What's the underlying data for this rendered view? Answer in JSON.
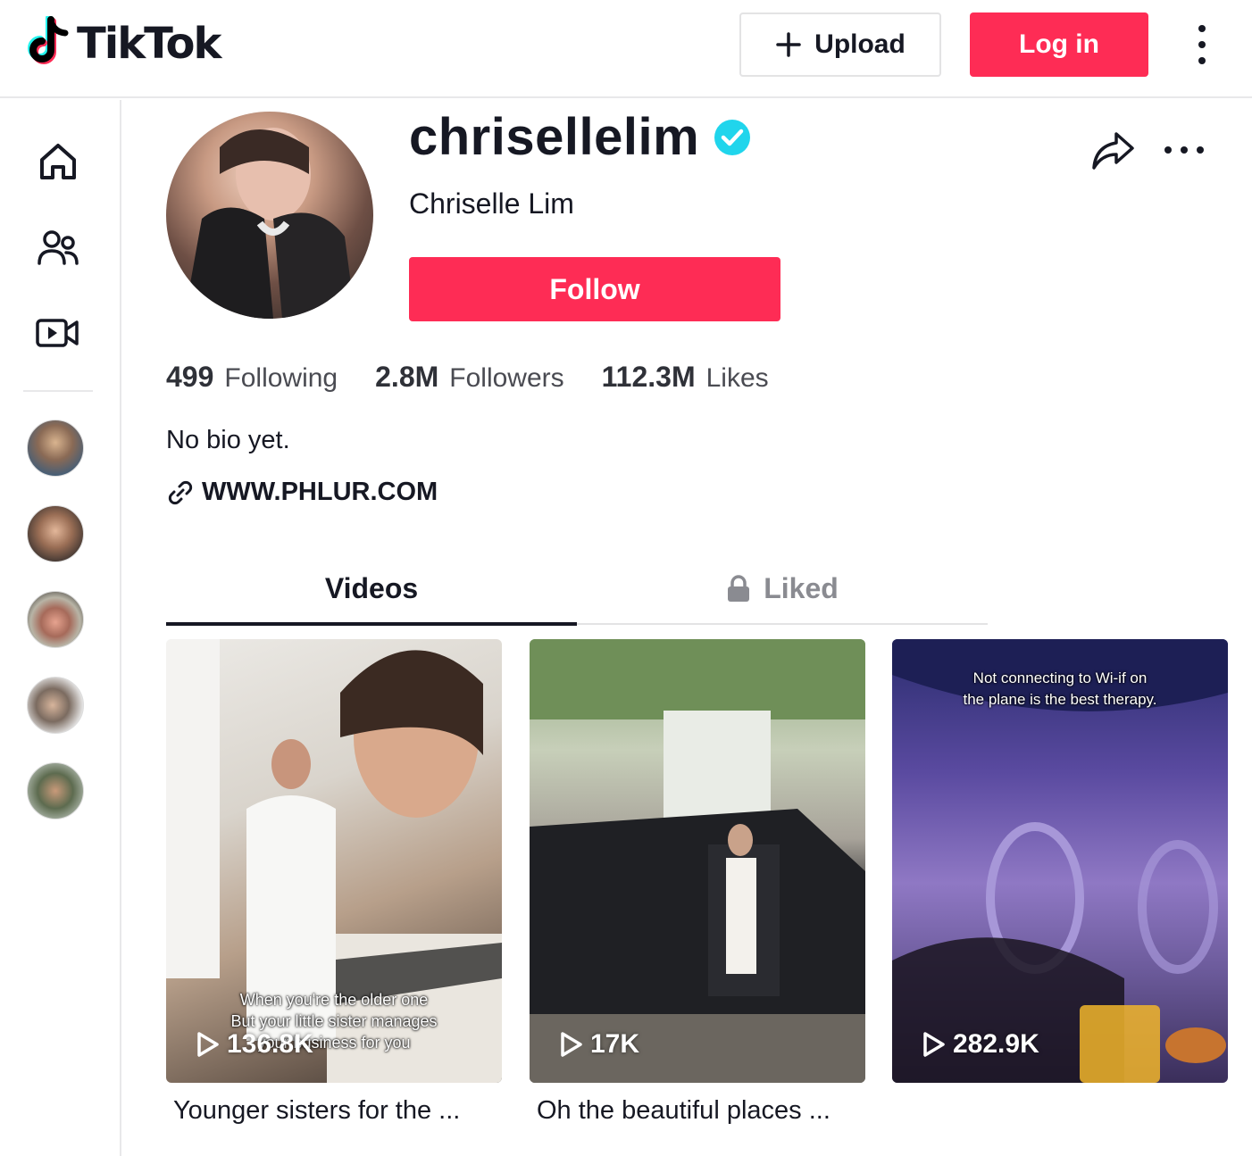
{
  "header": {
    "logo_text": "TikTok",
    "upload_label": "Upload",
    "login_label": "Log in"
  },
  "profile": {
    "username": "chrisellelim",
    "display_name": "Chriselle Lim",
    "verified": true,
    "follow_label": "Follow",
    "stats": [
      {
        "count": "499",
        "label": "Following"
      },
      {
        "count": "2.8M",
        "label": "Followers"
      },
      {
        "count": "112.3M",
        "label": "Likes"
      }
    ],
    "bio": "No bio yet.",
    "link": "WWW.PHLUR.COM"
  },
  "tabs": [
    {
      "label": "Videos",
      "active": true
    },
    {
      "label": "Liked",
      "active": false,
      "locked": true
    }
  ],
  "videos": [
    {
      "views": "136.8K",
      "overlay_text": [
        "When you're the older one",
        "But your little sister manages",
        "your business for you"
      ],
      "title": "Younger sisters for the ..."
    },
    {
      "views": "17K",
      "overlay_text": [],
      "title": "Oh the beautiful places ..."
    },
    {
      "views": "282.9K",
      "overlay_text": [
        "Not connecting to Wi-if on",
        "the plane is the best therapy."
      ],
      "title": ""
    }
  ],
  "sidebar": {
    "icons": [
      "home-icon",
      "following-icon",
      "live-icon"
    ],
    "suggested_accounts": 5
  },
  "colors": {
    "brand_red": "#fe2c55",
    "verified_blue": "#20d5ec",
    "text_dark": "#161823"
  }
}
